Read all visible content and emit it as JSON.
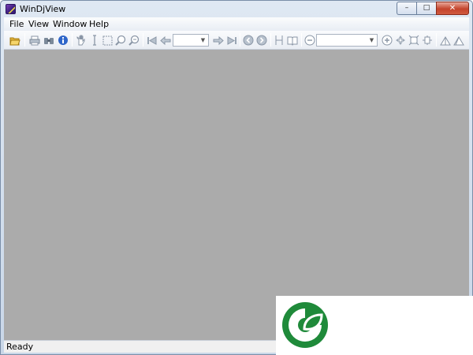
{
  "window": {
    "title": "WinDjView"
  },
  "caption": {
    "minimize": "–",
    "maximize": "□",
    "close": "✕"
  },
  "menu": [
    {
      "label": "File"
    },
    {
      "label": "View"
    },
    {
      "label": "Window"
    },
    {
      "label": "Help"
    }
  ],
  "toolbar": {
    "icons": [
      "open-icon",
      "print-icon",
      "find-icon",
      "info-icon",
      "hand-icon",
      "text-select-icon",
      "rect-select-icon",
      "zoom-in-tool-icon",
      "zoom-out-tool-icon",
      "first-page-icon",
      "previous-page-icon",
      "next-page-icon",
      "last-page-icon",
      "back-icon",
      "forward-icon",
      "single-page-icon",
      "two-pages-icon",
      "zoom-out-icon",
      "zoom-in-icon",
      "fit-page-icon",
      "actual-size-icon",
      "fit-width-icon",
      "rotate-left-icon",
      "rotate-right-icon"
    ],
    "page_combo": "",
    "zoom_combo": ""
  },
  "status": {
    "text": "Ready"
  },
  "colors": {
    "document_background": "#ababab",
    "logo_green": "#1f8a3a"
  }
}
